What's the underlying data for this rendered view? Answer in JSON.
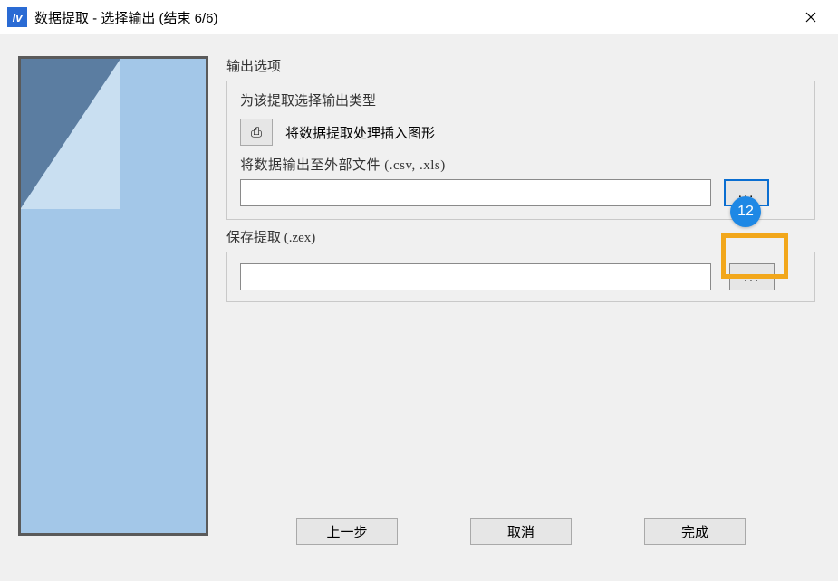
{
  "window": {
    "title": "数据提取 - 选择输出 (结束 6/6)",
    "app_icon_glyph": "Iv"
  },
  "output_options": {
    "group_label": "输出选项",
    "subtitle": "为该提取选择输出类型",
    "insert_icon": "⎙",
    "insert_label": "将数据提取处理插入图形",
    "export_label": "将数据输出至外部文件 (.csv, .xls)",
    "export_path": "",
    "browse_label": "..."
  },
  "save_extract": {
    "group_label": "保存提取 (.zex)",
    "path": "",
    "browse_label": "..."
  },
  "buttons": {
    "back": "上一步",
    "cancel": "取消",
    "finish": "完成"
  },
  "annotation": {
    "badge": "12"
  }
}
